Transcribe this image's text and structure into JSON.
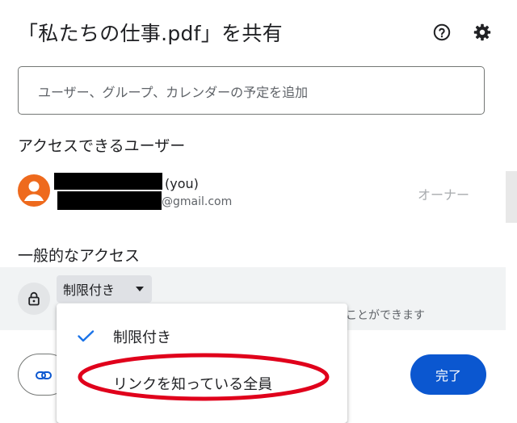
{
  "dialog": {
    "title": "「私たちの仕事.pdf」を共有",
    "help_icon": "help-circle-icon",
    "settings_icon": "gear-icon"
  },
  "add_people": {
    "placeholder": "ユーザー、グループ、カレンダーの予定を追加"
  },
  "people_with_access": {
    "label": "アクセスできるユーザー",
    "users": [
      {
        "name_suffix": "(you)",
        "email_suffix": "@gmail.com",
        "role": "オーナー"
      }
    ]
  },
  "general_access": {
    "label": "一般的なアクセス",
    "lock_icon": "lock-icon",
    "selected": "制限付き",
    "description_visible": "ことができます",
    "menu": [
      {
        "label": "制限付き",
        "checked": true
      },
      {
        "label": "リンクを知っている全員",
        "checked": false,
        "circled": true
      }
    ]
  },
  "footer": {
    "copy_link_icon": "link-icon",
    "done_label": "完了"
  },
  "colors": {
    "primary": "#0b57d0",
    "avatar": "#ee6a1d",
    "highlight_circle": "#e0001b",
    "check": "#1a73e8"
  }
}
